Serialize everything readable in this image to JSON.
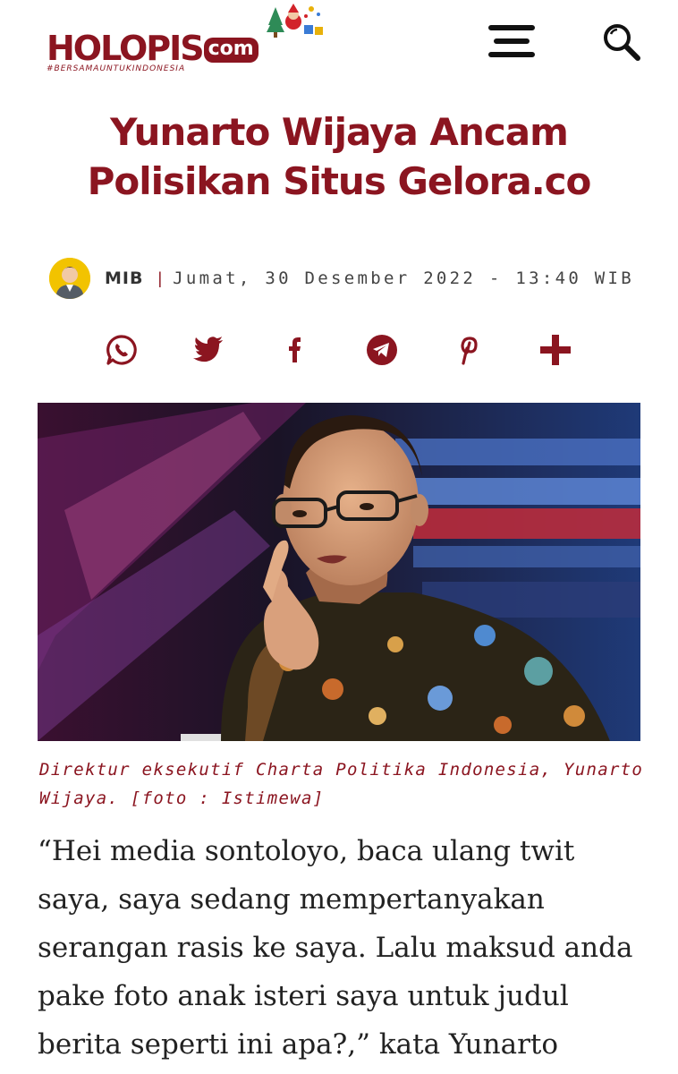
{
  "header": {
    "logo_main": "HOLOPIS",
    "logo_com": "com",
    "logo_tagline": "#BERSAMAUNTUKINDONESIA"
  },
  "article": {
    "title": "Yunarto Wijaya Ancam Polisikan Situs Gelora.co",
    "author": "MIB",
    "separator": "|",
    "date": "Jumat, 30 Desember 2022 - 13:40 WIB",
    "caption": "Direktur eksekutif Charta Politika Indonesia, Yunarto Wijaya. [foto : Istimewa]",
    "body": "“Hei media sontoloyo, baca ulang twit saya, saya sedang mempertanyakan serangan rasis ke saya. Lalu maksud anda pake foto anak isteri saya untuk judul berita seperti ini apa?,” kata Yunarto"
  },
  "share": [
    "whatsapp-icon",
    "twitter-icon",
    "facebook-icon",
    "telegram-icon",
    "pinterest-icon",
    "plus-icon"
  ],
  "colors": {
    "brand": "#8b1520",
    "icon": "#8b1520",
    "text": "#222222"
  }
}
